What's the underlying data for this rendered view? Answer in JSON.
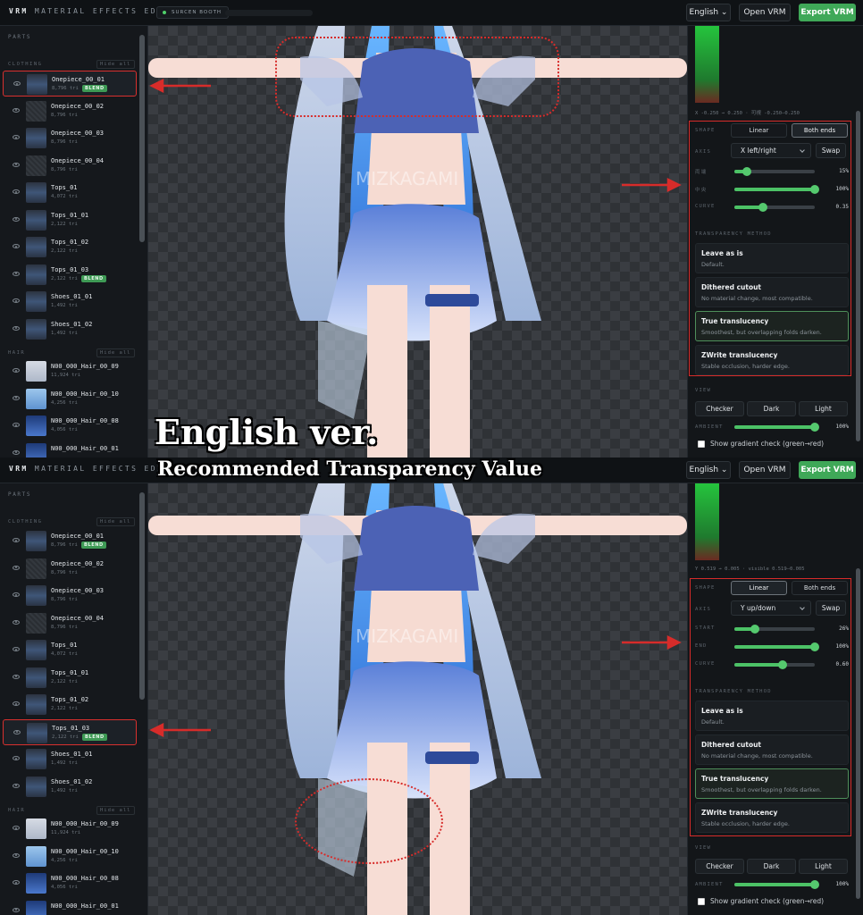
{
  "header": {
    "brand_strong": "VRM",
    "brand_rest": "MATERIAL EFFECTS EDITOR",
    "booth_badge": "SURCEN BOOTH",
    "language": "English",
    "open_vrm": "Open VRM",
    "export_vrm": "Export VRM"
  },
  "sidebar": {
    "parts_title": "PARTS",
    "clothing_title": "CLOTHING",
    "hair_title": "HAIR",
    "hide_all": "Hide all",
    "blend_badge": "BLEND",
    "clothing_items": [
      {
        "name": "Onepiece_00_01",
        "tris": "8,796 tri",
        "blend": true
      },
      {
        "name": "Onepiece_00_02",
        "tris": "8,796 tri",
        "blend": false
      },
      {
        "name": "Onepiece_00_03",
        "tris": "8,796 tri",
        "blend": false
      },
      {
        "name": "Onepiece_00_04",
        "tris": "8,796 tri",
        "blend": false
      },
      {
        "name": "Tops_01",
        "tris": "4,072 tri",
        "blend": false
      },
      {
        "name": "Tops_01_01",
        "tris": "2,122 tri",
        "blend": false
      },
      {
        "name": "Tops_01_02",
        "tris": "2,122 tri",
        "blend": false
      },
      {
        "name": "Tops_01_03",
        "tris": "2,122 tri",
        "blend": true
      },
      {
        "name": "Shoes_01_01",
        "tris": "1,492 tri",
        "blend": false
      },
      {
        "name": "Shoes_01_02",
        "tris": "1,492 tri",
        "blend": false
      }
    ],
    "hair_items": [
      {
        "name": "N00_000_Hair_00_09",
        "tris": "11,924 tri"
      },
      {
        "name": "N00_000_Hair_00_10",
        "tris": "4,256 tri"
      },
      {
        "name": "N00_000_Hair_00_08",
        "tris": "4,056 tri"
      },
      {
        "name": "N00_000_Hair_00_01",
        "tris": ""
      }
    ]
  },
  "viewport": {
    "watermark": "MIZKAGAMI"
  },
  "panelA": {
    "coord": "X -0.250 → 0.250 · 可視 -0.250–0.250",
    "shape_label": "SHAPE",
    "shape_options": [
      "Linear",
      "Both ends"
    ],
    "shape_selected": "Both ends",
    "axis_label": "AXIS",
    "axis_value": "X left/right",
    "swap": "Swap",
    "sliders": [
      {
        "label": "両端",
        "value": 0.15,
        "display": "15%"
      },
      {
        "label": "中央",
        "value": 1.0,
        "display": "100%"
      },
      {
        "label": "CURVE",
        "value": 0.35,
        "display": "0.35"
      }
    ]
  },
  "panelB": {
    "coord": "Y 0.519 → 0.005 · visible 0.519–0.005",
    "shape_label": "SHAPE",
    "shape_options": [
      "Linear",
      "Both ends"
    ],
    "shape_selected": "Linear",
    "axis_label": "AXIS",
    "axis_value": "Y up/down",
    "swap": "Swap",
    "sliders": [
      {
        "label": "START",
        "value": 0.26,
        "display": "26%"
      },
      {
        "label": "END",
        "value": 1.0,
        "display": "100%"
      },
      {
        "label": "CURVE",
        "value": 0.6,
        "display": "0.60"
      }
    ]
  },
  "transparency": {
    "title": "TRANSPARENCY METHOD",
    "selected_index": 2,
    "methods": [
      {
        "title": "Leave as is",
        "desc": "Default."
      },
      {
        "title": "Dithered cutout",
        "desc": "No material change, most compatible."
      },
      {
        "title": "True translucency",
        "desc": "Smoothest, but overlapping folds darken."
      },
      {
        "title": "ZWrite translucency",
        "desc": "Stable occlusion, harder edge."
      }
    ]
  },
  "view": {
    "title": "VIEW",
    "buttons": [
      "Checker",
      "Dark",
      "Light"
    ],
    "ambient_label": "AMBIENT",
    "ambient_value": 1.0,
    "ambient_display": "100%",
    "gradient_check": "Show gradient check (green→red)"
  },
  "annotation": {
    "line1": "English ver.",
    "line2": "Recommended Transparency Value"
  },
  "colors": {
    "accent": "#3fa858",
    "highlight": "#d72c2a",
    "selected_card": "#4e8f5a"
  }
}
